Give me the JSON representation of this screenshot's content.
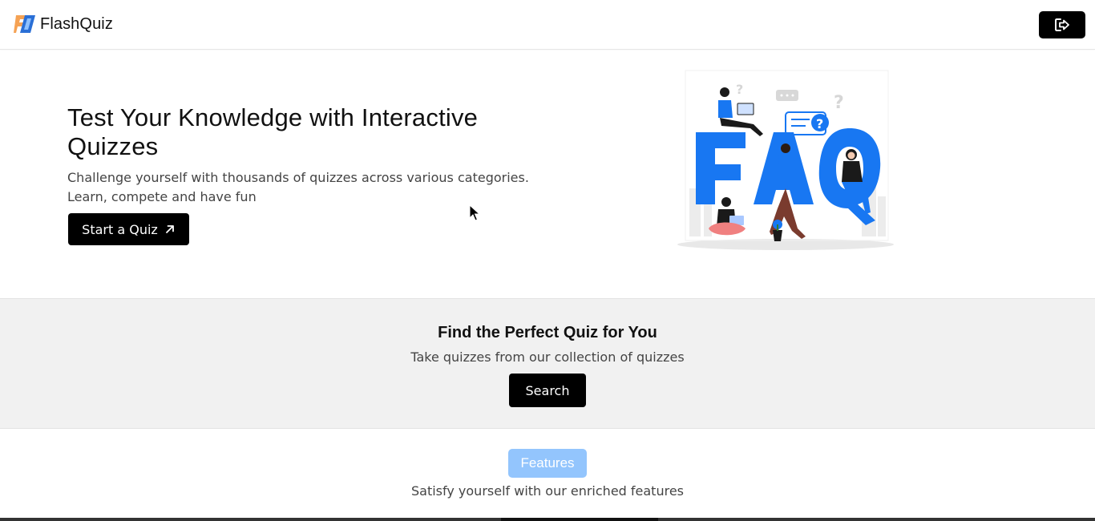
{
  "navbar": {
    "brand_name": "FlashQuiz",
    "logo_icon": "flashquiz-logo-icon",
    "logout_icon": "logout-icon"
  },
  "hero": {
    "title": "Test Your Knowledge with Interactive Quizzes",
    "subtitle": "Challenge yourself with thousands of quizzes across various categories. Learn, compete and have fun",
    "start_button_label": "Start a Quiz",
    "start_button_icon": "arrow-up-right-icon",
    "illustration": "faq-illustration"
  },
  "search_section": {
    "title": "Find the Perfect Quiz for You",
    "subtitle": "Take quizzes from our collection of quizzes",
    "search_button_label": "Search"
  },
  "features": {
    "badge_label": "Features",
    "subtitle": "Satisfy yourself with our enriched features"
  },
  "colors": {
    "primary_button": "#000000",
    "features_badge": "#93c5fd",
    "section_background": "#f1f1f1",
    "faq_blue": "#1877f2"
  }
}
